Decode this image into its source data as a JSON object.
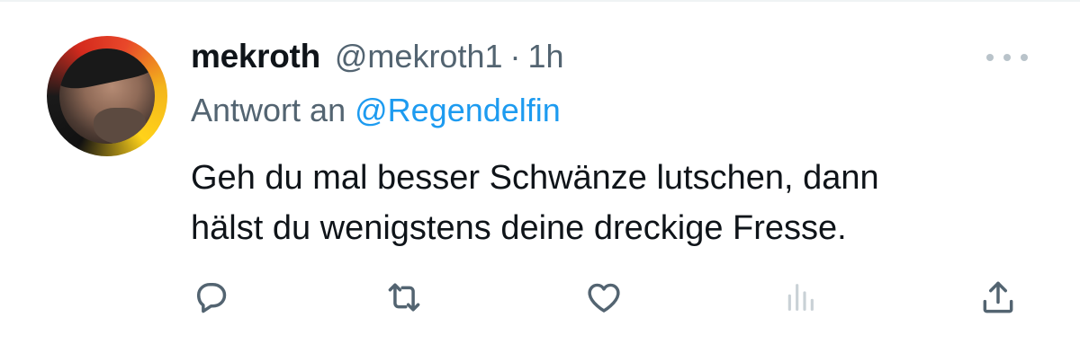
{
  "tweet": {
    "author": {
      "display_name": "mekroth",
      "handle": "@mekroth1",
      "separator": "·",
      "time": "1h"
    },
    "reply_to": {
      "prefix": "Antwort an",
      "mention": "@Regendelfin"
    },
    "text_line1": "Geh du mal besser Schwänze lutschen, dann",
    "text_line2": "hälst du wenigstens deine dreckige Fresse."
  },
  "icons": {
    "more": "more-horizontal-icon",
    "reply": "reply-bubble-icon",
    "retweet": "retweet-icon",
    "like": "heart-icon",
    "views": "bar-chart-icon",
    "share": "share-upload-icon"
  },
  "colors": {
    "text_primary": "#0f1419",
    "text_secondary": "#536471",
    "link": "#1d9bf0",
    "views_icon": "#c9d1d6"
  }
}
